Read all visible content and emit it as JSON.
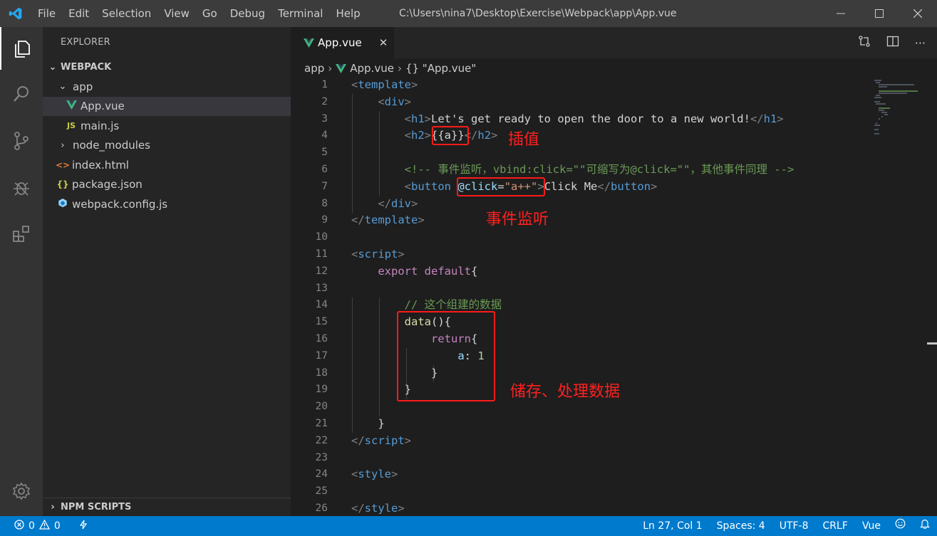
{
  "titlebar": {
    "menu": [
      "File",
      "Edit",
      "Selection",
      "View",
      "Go",
      "Debug",
      "Terminal",
      "Help"
    ],
    "window_title": "C:\\Users\\nina7\\Desktop\\Exercise\\Webpack\\app\\App.vue"
  },
  "sidebar": {
    "title": "EXPLORER",
    "section": "WEBPACK",
    "tree": [
      {
        "label": "app",
        "type": "folder-open",
        "depth": 1
      },
      {
        "label": "App.vue",
        "type": "vue",
        "depth": 2,
        "selected": true
      },
      {
        "label": "main.js",
        "type": "js",
        "depth": 2
      },
      {
        "label": "node_modules",
        "type": "folder",
        "depth": 1
      },
      {
        "label": "index.html",
        "type": "html",
        "depth": 1
      },
      {
        "label": "package.json",
        "type": "json",
        "depth": 1
      },
      {
        "label": "webpack.config.js",
        "type": "config",
        "depth": 1
      }
    ],
    "npm_section": "NPM SCRIPTS"
  },
  "editor": {
    "tab_label": "App.vue",
    "breadcrumb": [
      "app",
      "App.vue",
      "{} \"App.vue\""
    ],
    "line_numbers": [
      "1",
      "2",
      "3",
      "4",
      "5",
      "6",
      "7",
      "8",
      "9",
      "10",
      "11",
      "12",
      "13",
      "14",
      "15",
      "16",
      "17",
      "18",
      "19",
      "20",
      "21",
      "22",
      "23",
      "24",
      "25",
      "26"
    ]
  },
  "annotations": {
    "interpolation": "插值",
    "event_listener": "事件监听",
    "data_storage": "储存、处理数据"
  },
  "statusbar": {
    "errors": "0",
    "warnings": "0",
    "position": "Ln 27, Col 1",
    "spaces": "Spaces: 4",
    "encoding": "UTF-8",
    "eol": "CRLF",
    "language": "Vue"
  },
  "colors": {
    "accent": "#007acc",
    "vue_green": "#41b883",
    "annotation_red": "#ff1a1a"
  }
}
